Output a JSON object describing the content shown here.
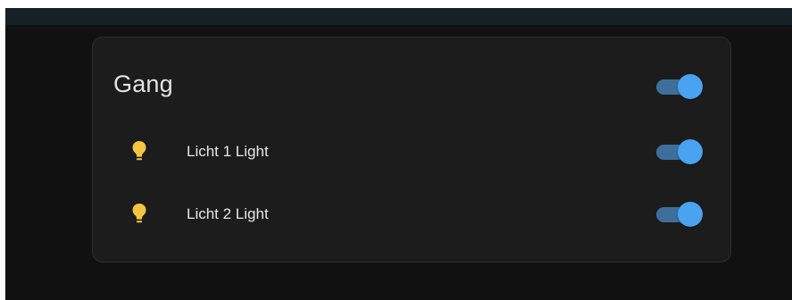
{
  "card": {
    "title": "Gang",
    "master_toggle": {
      "on": true
    },
    "entities": [
      {
        "label": "Licht 1 Light",
        "icon": "lightbulb-icon",
        "on": true
      },
      {
        "label": "Licht 2 Light",
        "icon": "lightbulb-icon",
        "on": true
      }
    ]
  },
  "colors": {
    "background": "#111111",
    "topbar": "#162127",
    "card": "#1c1c1c",
    "toggle_thumb": "#4aa3f0",
    "toggle_track": "#3e6f9c",
    "bulb": "#f4c541"
  }
}
